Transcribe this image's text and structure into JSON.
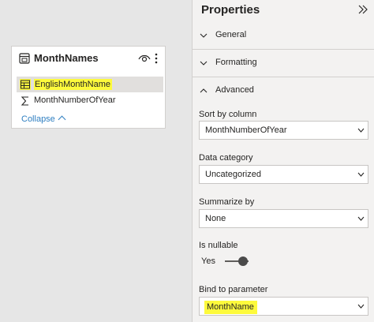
{
  "table_card": {
    "title": "MonthNames",
    "icons": {
      "table": "table-icon",
      "visibility": "eye-icon",
      "more": "more-options-icon"
    },
    "fields": [
      {
        "label": "EnglishMonthName",
        "icon": "column-icon",
        "selected": true,
        "highlighted": true
      },
      {
        "label": "MonthNumberOfYear",
        "icon": "sigma-icon",
        "selected": false,
        "highlighted": false
      }
    ],
    "collapse_label": "Collapse"
  },
  "properties": {
    "title": "Properties",
    "collapse_icon": "double-chevron-right-icon",
    "sections": [
      {
        "label": "General",
        "expanded": false
      },
      {
        "label": "Formatting",
        "expanded": false
      },
      {
        "label": "Advanced",
        "expanded": true
      }
    ],
    "sort_by_column": {
      "label": "Sort by column",
      "value": "MonthNumberOfYear"
    },
    "data_category": {
      "label": "Data category",
      "value": "Uncategorized"
    },
    "summarize_by": {
      "label": "Summarize by",
      "value": "None"
    },
    "is_nullable": {
      "label": "Is nullable",
      "state_label": "Yes",
      "on": true
    },
    "bind_to_parameter": {
      "label": "Bind to parameter",
      "value": "MonthName",
      "highlighted": true
    }
  },
  "colors": {
    "highlight": "#fdfa3c",
    "link": "#2f7fc1",
    "pane_bg": "#f3f2f1",
    "canvas_bg": "#e6e6e6"
  }
}
